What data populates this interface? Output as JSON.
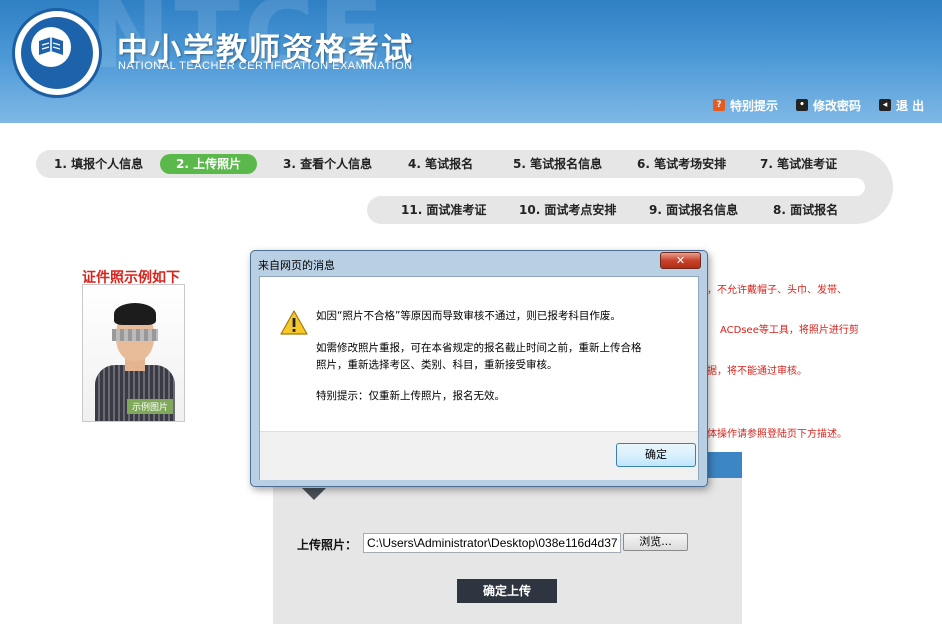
{
  "header": {
    "watermark": "NTCE",
    "title": "中小学教师资格考试",
    "subtitle": "NATIONAL TEACHER CERTIFICATION EXAMINATION",
    "links": [
      {
        "label": "特别提示",
        "icon": "info-icon"
      },
      {
        "label": "修改密码",
        "icon": "password-icon"
      },
      {
        "label": "退 出",
        "icon": "exit-icon"
      }
    ]
  },
  "steps": {
    "row1": [
      "1. 填报个人信息",
      "2. 上传照片",
      "3. 查看个人信息",
      "4. 笔试报名",
      "5. 笔试报名信息",
      "6. 笔试考场安排",
      "7. 笔试准考证"
    ],
    "row2": [
      "11. 面试准考证",
      "10. 面试考点安排",
      "9. 面试报名信息",
      "8. 面试报名"
    ],
    "active_index": 1
  },
  "example": {
    "title": "证件照示例如下",
    "tag": "示例图片"
  },
  "right_notes": [
    "，不允许戴帽子、头巾、发带、",
    "ACDsee等工具，将照片进行剪",
    "据，将不能通过审核。",
    "体操作请参照登陆页下方描述。"
  ],
  "upload": {
    "label": "上传照片：",
    "file_value": "C:\\Users\\Administrator\\Desktop\\038e116d4d37",
    "browse_label": "浏览...",
    "confirm_label": "确定上传"
  },
  "dialog": {
    "title": "来自网页的消息",
    "close_label": "✕",
    "lines": [
      "如因“照片不合格”等原因而导致审核不通过，则已报考科目作废。",
      "如需修改照片重报，可在本省规定的报名截止时间之前，重新上传合格",
      "照片，重新选择考区、类别、科目，重新接受审核。",
      "特别提示：仅重新上传照片，报名无效。"
    ],
    "ok_label": "确定"
  },
  "colors": {
    "header_blue": "#2f7fc4",
    "active_step": "#5bb94b",
    "note_red": "#d9231c",
    "dark_button": "#2f3540"
  }
}
